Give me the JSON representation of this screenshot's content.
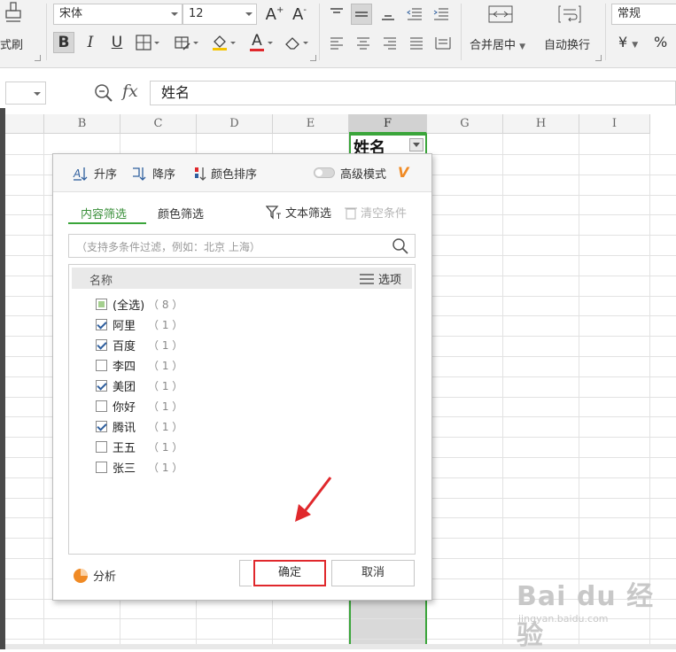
{
  "ribbon": {
    "format_painter_label": "式刷",
    "font_name": "宋体",
    "font_size": "12",
    "bold": "B",
    "italic": "I",
    "underline": "U",
    "grow_font": "A",
    "shrink_font": "A",
    "font_color_glyph": "A",
    "merge_center_label": "合并居中",
    "wrap_text_label": "自动换行",
    "number_format": "常规",
    "currency_glyph": "¥",
    "percent_glyph": "%"
  },
  "formula_bar": {
    "fx_label": "fx",
    "value": "姓名"
  },
  "columns": [
    {
      "label": "B",
      "selected": false
    },
    {
      "label": "C",
      "selected": false
    },
    {
      "label": "D",
      "selected": false
    },
    {
      "label": "E",
      "selected": false
    },
    {
      "label": "F",
      "selected": true
    },
    {
      "label": "G",
      "selected": false
    },
    {
      "label": "H",
      "selected": false
    },
    {
      "label": "I",
      "selected": false
    }
  ],
  "header_cell": {
    "text": "姓名"
  },
  "filter_popup": {
    "sort_asc": "升序",
    "sort_desc": "降序",
    "sort_color": "颜色排序",
    "advanced_mode": "高级模式",
    "vip_glyph": "V",
    "tabs": {
      "content": "内容筛选",
      "color": "颜色筛选"
    },
    "text_filter": "文本筛选",
    "clear_conditions": "清空条件",
    "search_placeholder": "（支持多条件过滤，例如：北京 上海）",
    "list_header": {
      "name": "名称",
      "options": "选项"
    },
    "items": [
      {
        "label": "(全选)",
        "count": "（ 8 ）",
        "state": "partial"
      },
      {
        "label": "阿里",
        "count": "（ 1 ）",
        "state": "checked"
      },
      {
        "label": "百度",
        "count": "（ 1 ）",
        "state": "checked"
      },
      {
        "label": "李四",
        "count": "（ 1 ）",
        "state": "unchecked"
      },
      {
        "label": "美团",
        "count": "（ 1 ）",
        "state": "checked"
      },
      {
        "label": "你好",
        "count": "（ 1 ）",
        "state": "unchecked"
      },
      {
        "label": "腾讯",
        "count": "（ 1 ）",
        "state": "checked"
      },
      {
        "label": "王五",
        "count": "（ 1 ）",
        "state": "unchecked"
      },
      {
        "label": "张三",
        "count": "（ 1 ）",
        "state": "unchecked"
      }
    ],
    "analyze": "分析",
    "ok": "确定",
    "cancel": "取消"
  },
  "watermark": {
    "main": "Bai du 经验",
    "sub": "jingyan.baidu.com"
  },
  "colors": {
    "accent_green": "#3aa53a",
    "highlight_red": "#e0282c",
    "vip_orange": "#f08a24"
  }
}
